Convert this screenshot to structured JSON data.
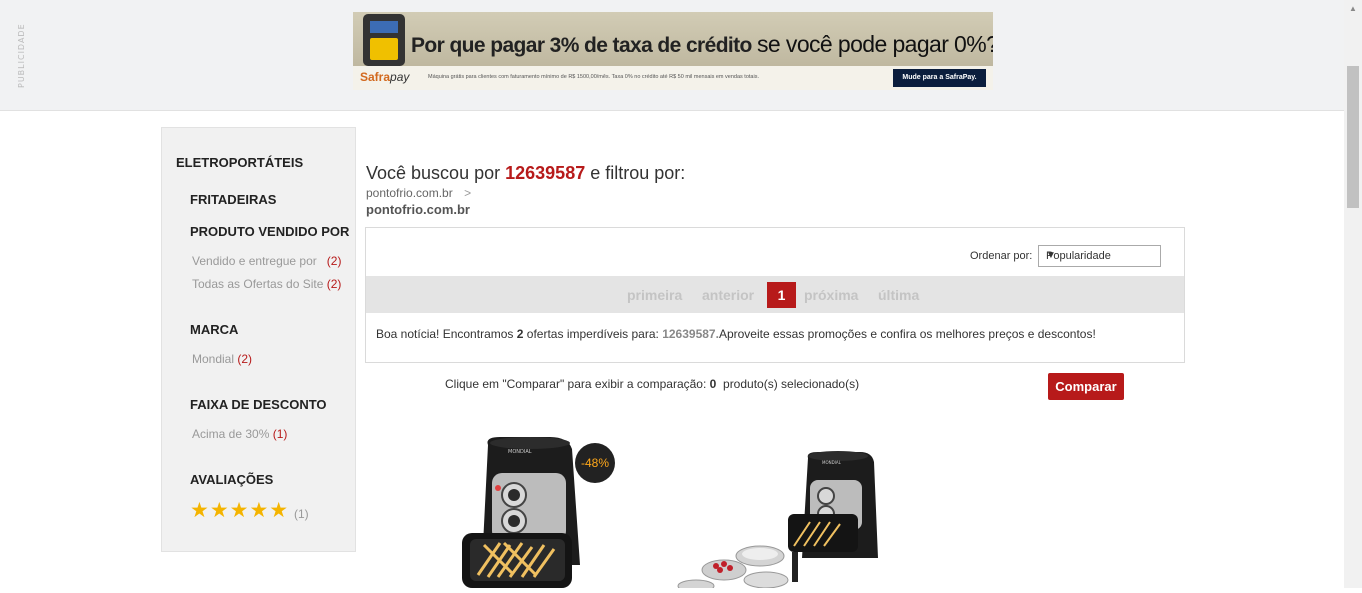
{
  "ad": {
    "side_label": "PUBLICIDADE",
    "headline_part1": "Por que pagar 3% de taxa de crédito",
    "headline_part2": "se você pode pagar 0%?",
    "brand_a": "Safra",
    "brand_b": "pay",
    "fine_print": "Máquina grátis para clientes com faturamento mínimo de R$ 1500,00/mês. Taxa 0% no crédito até R$ 50 mil mensais em vendas totais.",
    "cta": "Mude para a SafraPay."
  },
  "sidebar": {
    "category": "ELETROPORTÁTEIS",
    "subcategory": "FRITADEIRAS",
    "sections": {
      "seller": {
        "title": "PRODUTO VENDIDO POR",
        "items": [
          {
            "label": "Vendido e entregue por",
            "count": "(2)"
          },
          {
            "label": "Todas as Ofertas do Site",
            "count": "(2)"
          }
        ]
      },
      "brand": {
        "title": "MARCA",
        "items": [
          {
            "label": "Mondial",
            "count": "(2)"
          }
        ]
      },
      "discount": {
        "title": "FAIXA DE DESCONTO",
        "items": [
          {
            "label": "Acima de 30%",
            "count": "(1)"
          }
        ]
      },
      "rating": {
        "title": "AVALIAÇÕES",
        "stars": "★★★★★",
        "count": "(1)"
      }
    }
  },
  "search": {
    "prefix": "Você buscou por",
    "term": "12639587",
    "suffix": "e filtrou por:",
    "crumb_store": "pontofrio.com.br",
    "crumb_sep": ">",
    "crumb_filter": "pontofrio.com.br"
  },
  "sort": {
    "label": "Ordenar por:",
    "selected": "Popularidade"
  },
  "pagination": {
    "first": "primeira",
    "prev": "anterior",
    "current": "1",
    "next": "próxima",
    "last": "última"
  },
  "results_message": {
    "part1": "Boa notícia! Encontramos",
    "count": "2",
    "part2": "ofertas imperdíveis para:",
    "term": "12639587.",
    "part3": "Aproveite essas promoções e confira os melhores preços e descontos!"
  },
  "compare": {
    "part1": "Clique em \"Comparar\" para exibir a comparação:",
    "count": "0",
    "part2": "produto(s) selecionado(s)",
    "button": "Comparar"
  },
  "products": [
    {
      "badge": "-48%",
      "brand_text": "MONDIAL"
    },
    {
      "brand_text": "MONDIAL"
    }
  ]
}
